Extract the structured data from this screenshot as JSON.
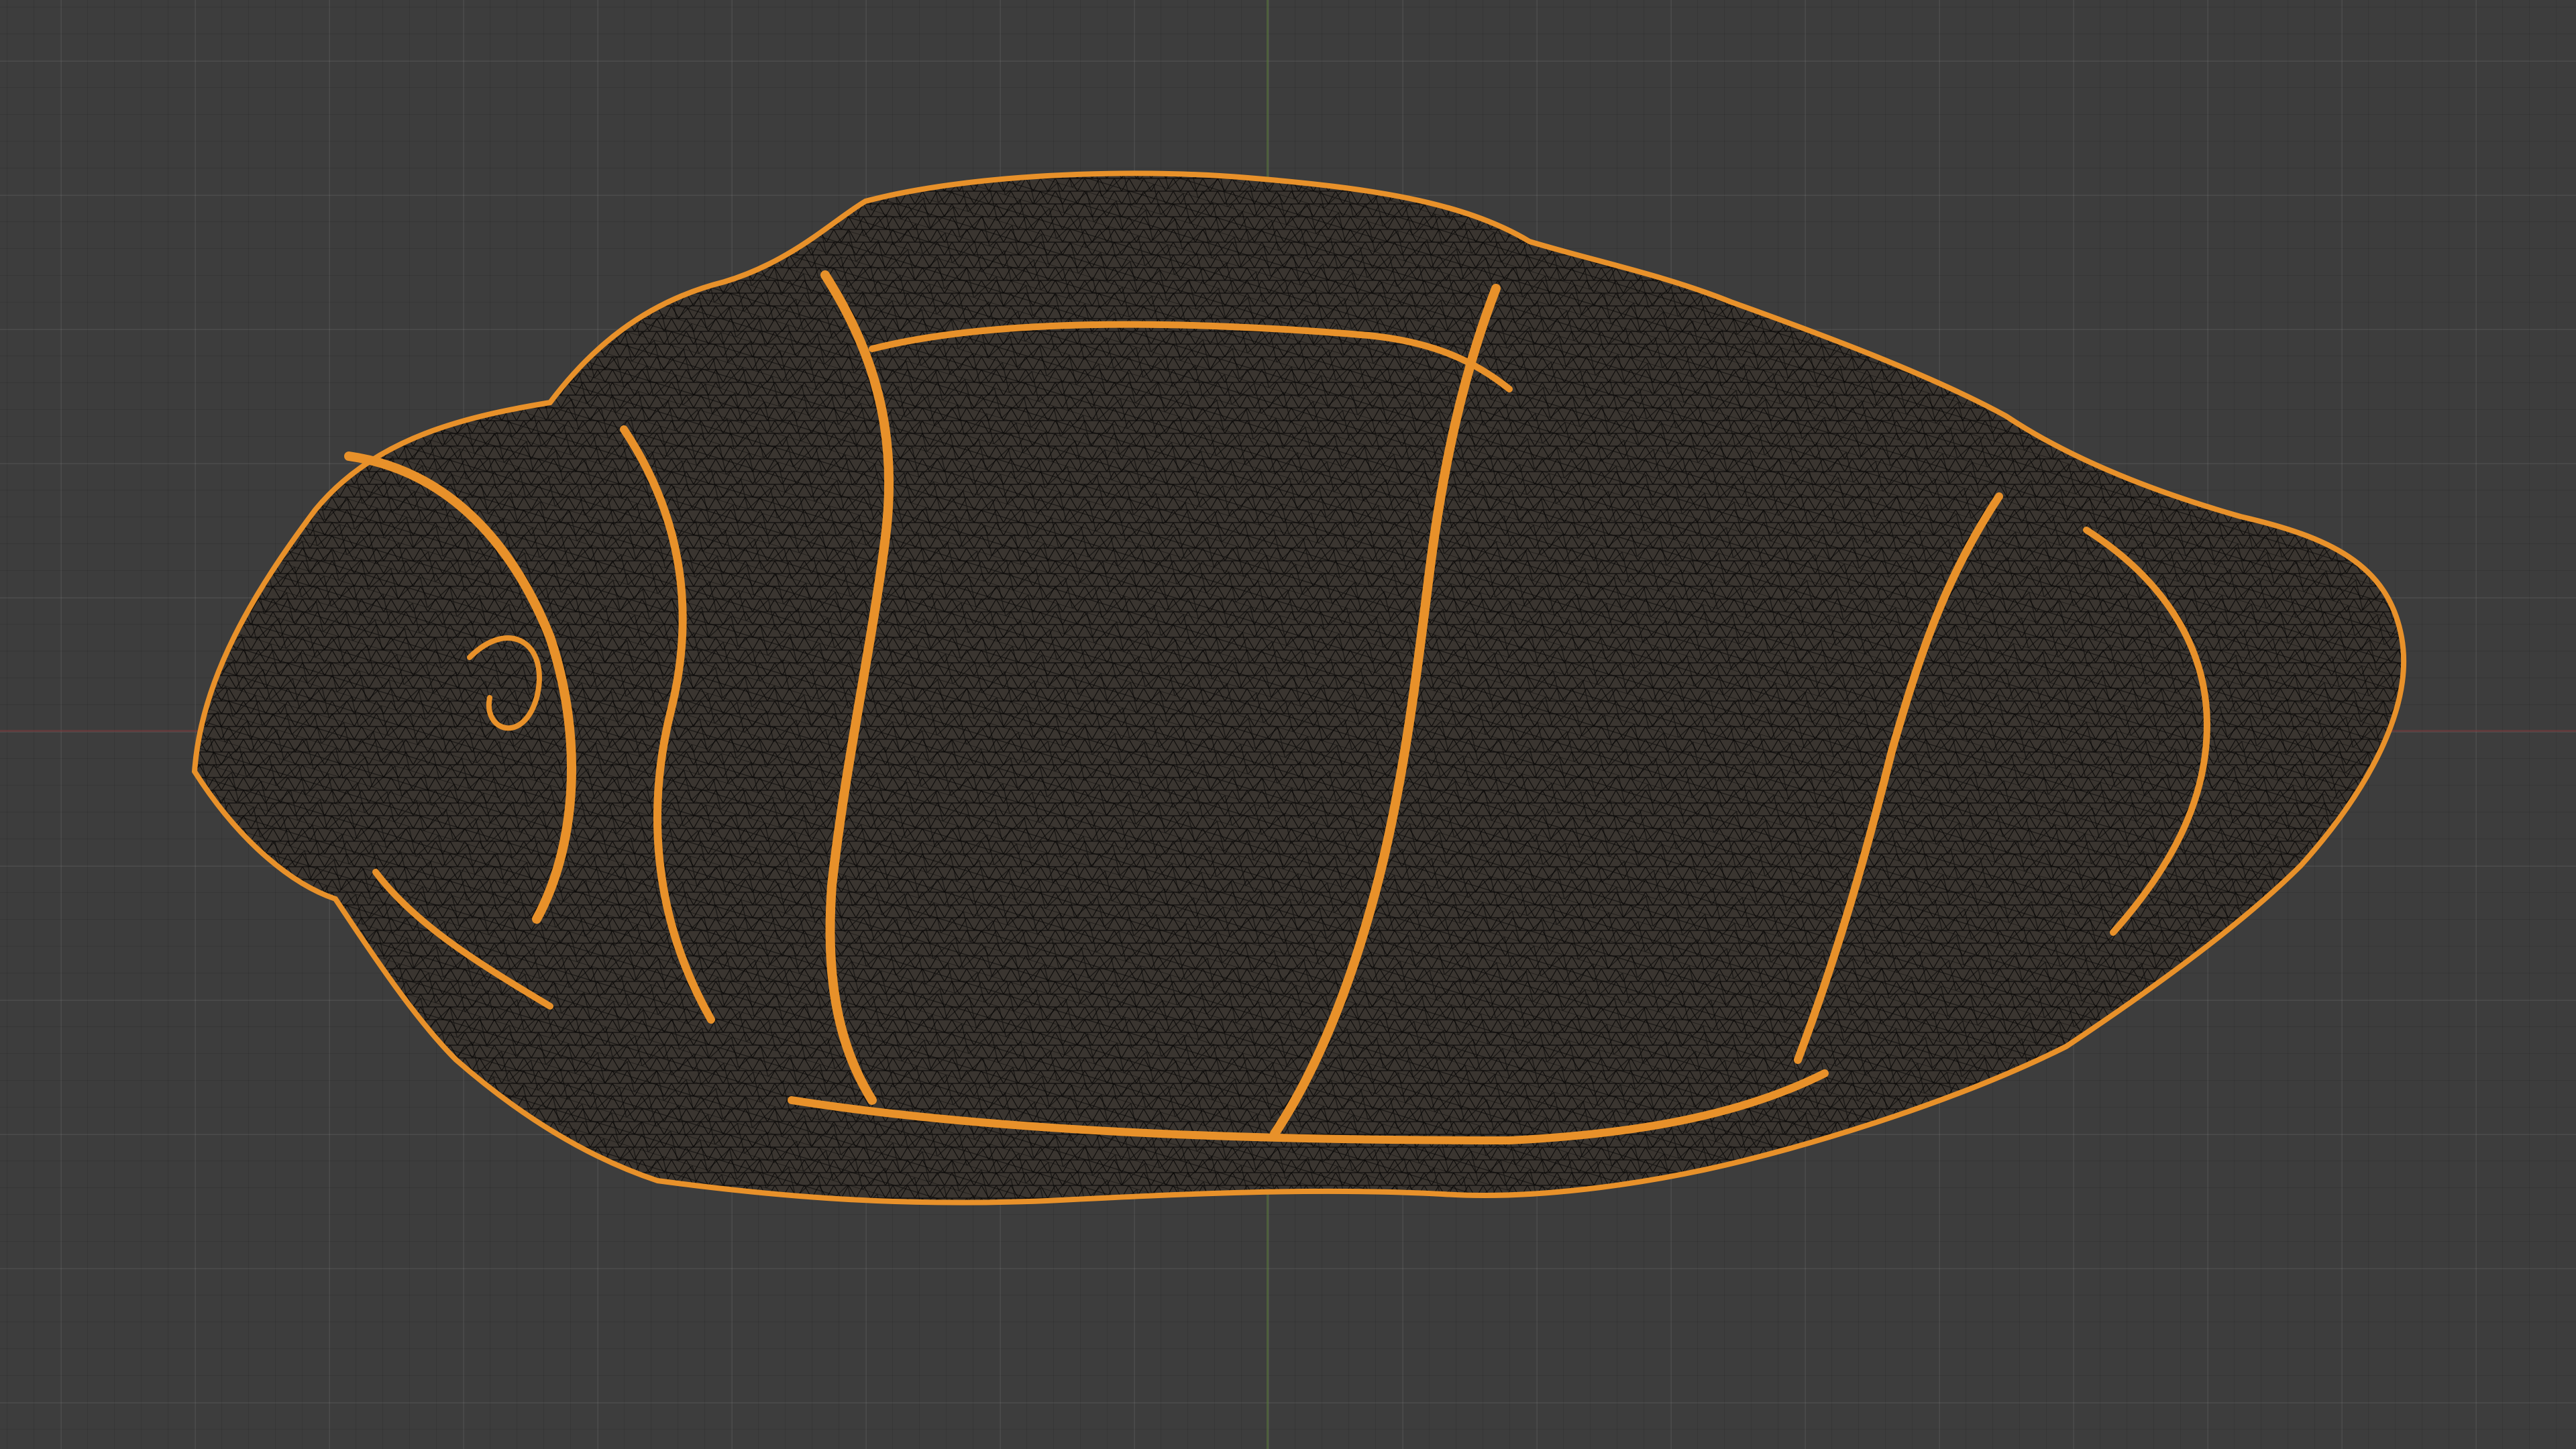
{
  "viewport": {
    "background_color": "#3d3d3d",
    "grid_color": "#4a4a4a",
    "axis_x_color": "#7a3a3d",
    "axis_y_color": "#5a7a3a"
  },
  "object": {
    "kind": "wireframe mesh",
    "wire_color": "#e8912a",
    "fill_color": "#3a3530",
    "selected": true
  }
}
